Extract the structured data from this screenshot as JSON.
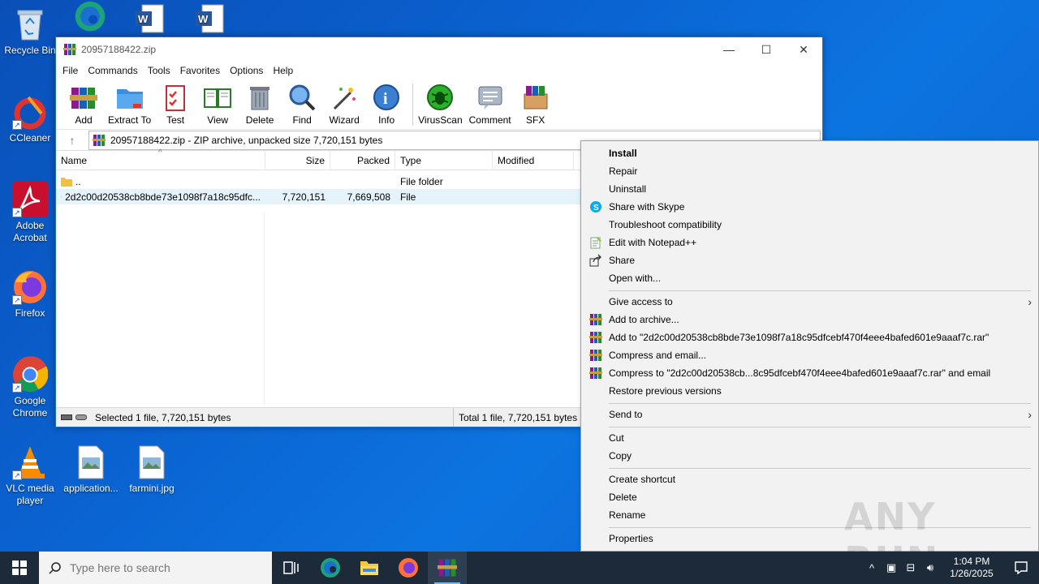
{
  "desktop": {
    "icons": [
      {
        "label": "Recycle Bin"
      },
      {
        "label": "CCleaner"
      },
      {
        "label": "Adobe Acrobat"
      },
      {
        "label": "Firefox"
      },
      {
        "label": "Google Chrome"
      },
      {
        "label": "VLC media player"
      },
      {
        "label": "application..."
      },
      {
        "label": "farmini.jpg"
      }
    ]
  },
  "window": {
    "title": "20957188422.zip",
    "controls": {
      "minimize": "—",
      "maximize": "☐",
      "close": "✕"
    },
    "menu": [
      "File",
      "Commands",
      "Tools",
      "Favorites",
      "Options",
      "Help"
    ],
    "toolbar": [
      "Add",
      "Extract To",
      "Test",
      "View",
      "Delete",
      "Find",
      "Wizard",
      "Info",
      "VirusScan",
      "Comment",
      "SFX"
    ],
    "address": "20957188422.zip - ZIP archive, unpacked size 7,720,151 bytes",
    "columns": {
      "name": "Name",
      "size": "Size",
      "packed": "Packed",
      "type": "Type",
      "modified": "Modified"
    },
    "rows": [
      {
        "name": "..",
        "size": "",
        "packed": "",
        "type": "File folder"
      },
      {
        "name": "2d2c00d20538cb8bde73e1098f7a18c95dfc...",
        "size": "7,720,151",
        "packed": "7,669,508",
        "type": "File"
      }
    ],
    "status_left": "Selected 1 file, 7,720,151 bytes",
    "status_right": "Total 1 file, 7,720,151 bytes"
  },
  "context_menu": {
    "items": [
      "Install",
      "Repair",
      "Uninstall",
      "Share with Skype",
      "Troubleshoot compatibility",
      "Edit with Notepad++",
      "Share",
      "Open with...",
      "Give access to",
      "Add to archive...",
      "Add to \"2d2c00d20538cb8bde73e1098f7a18c95dfcebf470f4eee4bafed601e9aaaf7c.rar\"",
      "Compress and email...",
      "Compress to \"2d2c00d20538cb...8c95dfcebf470f4eee4bafed601e9aaaf7c.rar\" and email",
      "Restore previous versions",
      "Send to",
      "Cut",
      "Copy",
      "Create shortcut",
      "Delete",
      "Rename",
      "Properties"
    ]
  },
  "watermark": "ANY RUN",
  "taskbar": {
    "search_placeholder": "Type here to search",
    "time": "1:04 PM",
    "date": "1/26/2025"
  }
}
